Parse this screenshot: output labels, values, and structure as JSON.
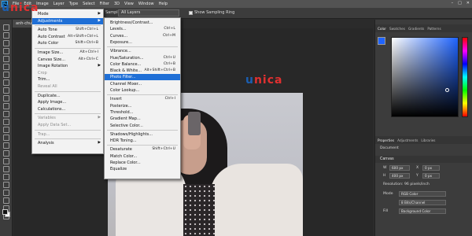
{
  "app": {
    "menus": [
      "File",
      "Edit",
      "Image",
      "Layer",
      "Type",
      "Select",
      "Filter",
      "3D",
      "View",
      "Window",
      "Help"
    ],
    "win_min": "–",
    "win_max": "□",
    "win_close": "✕"
  },
  "options": {
    "sample_label": "Sample:",
    "sample_value": "All Layers",
    "ring_label": "Show Sampling Ring"
  },
  "doc_tab": "anh-chu...",
  "logo": {
    "u": "u",
    "nica": "nica"
  },
  "image_menu": {
    "items": [
      {
        "label": "Mode",
        "shortcut": "",
        "arrow": "▶",
        "disabled": false
      },
      {
        "label": "Adjustments",
        "shortcut": "",
        "arrow": "▶",
        "disabled": false,
        "highlight": true
      },
      {
        "label": "Auto Tone",
        "shortcut": "Shift+Ctrl+L",
        "arrow": "",
        "disabled": false
      },
      {
        "label": "Auto Contrast",
        "shortcut": "Alt+Shift+Ctrl+L",
        "arrow": "",
        "disabled": false
      },
      {
        "label": "Auto Color",
        "shortcut": "Shift+Ctrl+B",
        "arrow": "",
        "disabled": false
      },
      {
        "label": "Image Size...",
        "shortcut": "Alt+Ctrl+I",
        "arrow": "",
        "disabled": false
      },
      {
        "label": "Canvas Size...",
        "shortcut": "Alt+Ctrl+C",
        "arrow": "",
        "disabled": false
      },
      {
        "label": "Image Rotation",
        "shortcut": "",
        "arrow": "▶",
        "disabled": false
      },
      {
        "label": "Crop",
        "shortcut": "",
        "arrow": "",
        "disabled": true
      },
      {
        "label": "Trim...",
        "shortcut": "",
        "arrow": "",
        "disabled": false
      },
      {
        "label": "Reveal All",
        "shortcut": "",
        "arrow": "",
        "disabled": true
      },
      {
        "label": "Duplicate...",
        "shortcut": "",
        "arrow": "",
        "disabled": false
      },
      {
        "label": "Apply Image...",
        "shortcut": "",
        "arrow": "",
        "disabled": false
      },
      {
        "label": "Calculations...",
        "shortcut": "",
        "arrow": "",
        "disabled": false
      },
      {
        "label": "Variables",
        "shortcut": "",
        "arrow": "▶",
        "disabled": true
      },
      {
        "label": "Apply Data Set...",
        "shortcut": "",
        "arrow": "",
        "disabled": true
      },
      {
        "label": "Trap...",
        "shortcut": "",
        "arrow": "",
        "disabled": true
      },
      {
        "label": "Analysis",
        "shortcut": "",
        "arrow": "▶",
        "disabled": false
      }
    ]
  },
  "adjust_menu": {
    "items": [
      {
        "label": "Brightness/Contrast...",
        "shortcut": ""
      },
      {
        "label": "Levels...",
        "shortcut": "Ctrl+L"
      },
      {
        "label": "Curves...",
        "shortcut": "Ctrl+M"
      },
      {
        "label": "Exposure...",
        "shortcut": ""
      },
      {
        "label": "Vibrance...",
        "shortcut": ""
      },
      {
        "label": "Hue/Saturation...",
        "shortcut": "Ctrl+U"
      },
      {
        "label": "Color Balance...",
        "shortcut": "Ctrl+B"
      },
      {
        "label": "Black & White...",
        "shortcut": "Alt+Shift+Ctrl+B"
      },
      {
        "label": "Photo Filter...",
        "shortcut": "",
        "highlight": true
      },
      {
        "label": "Channel Mixer...",
        "shortcut": ""
      },
      {
        "label": "Color Lookup...",
        "shortcut": ""
      },
      {
        "label": "Invert",
        "shortcut": "Ctrl+I"
      },
      {
        "label": "Posterize...",
        "shortcut": ""
      },
      {
        "label": "Threshold...",
        "shortcut": ""
      },
      {
        "label": "Gradient Map...",
        "shortcut": ""
      },
      {
        "label": "Selective Color...",
        "shortcut": ""
      },
      {
        "label": "Shadows/Highlights...",
        "shortcut": ""
      },
      {
        "label": "HDR Toning...",
        "shortcut": ""
      },
      {
        "label": "Desaturate",
        "shortcut": "Shift+Ctrl+U"
      },
      {
        "label": "Match Color...",
        "shortcut": ""
      },
      {
        "label": "Replace Color...",
        "shortcut": ""
      },
      {
        "label": "Equalize",
        "shortcut": ""
      }
    ]
  },
  "panels": {
    "color_tabs": [
      "Color",
      "Swatches",
      "Gradients",
      "Patterns"
    ],
    "props_tabs": [
      "Properties",
      "Adjustments",
      "Libraries"
    ],
    "document_label": "Document",
    "canvas_section": "Canvas",
    "w_label": "W",
    "w_value": "600 px",
    "h_label": "H",
    "h_value": "400 px",
    "x_label": "X",
    "x_value": "0 px",
    "y_label": "Y",
    "y_value": "0 px",
    "resolution": "Resolution: 96 pixels/inch",
    "mode_label": "Mode",
    "mode_value": "RGB Color",
    "depth_value": "8 Bits/Channel",
    "fill_label": "Fill",
    "fill_value": "Background Color"
  },
  "colors": {
    "accent": "#1f6fd6",
    "picker": "#1f64ff",
    "logo_blue": "#1b5fb2",
    "logo_red": "#e03030"
  }
}
